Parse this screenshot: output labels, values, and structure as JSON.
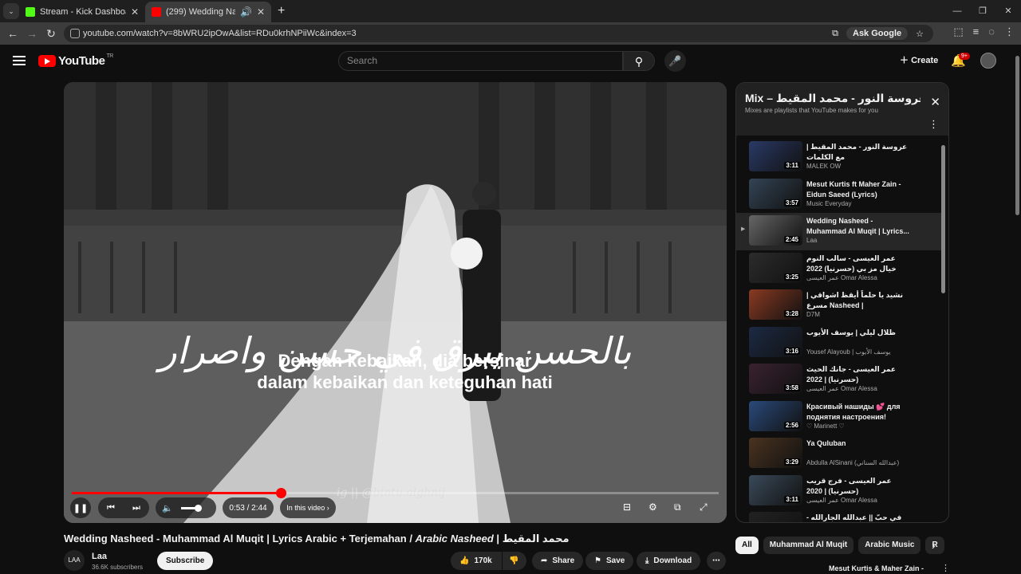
{
  "browser": {
    "tabs": [
      {
        "title": "Stream - Kick Dashboard",
        "favicon_color": "#53fc18"
      },
      {
        "title": "(299) Wedding Nasheed - M",
        "favicon_color": "#ff0000"
      }
    ],
    "url": "youtube.com/watch?v=8bWRU2ipOwA&list=RDu0krhNPiiWc&index=3",
    "ask_google": "Ask Google"
  },
  "header": {
    "logo": "YouTube",
    "logo_region": "TR",
    "search_placeholder": "Search",
    "create_label": "Create",
    "notif_badge": "9+"
  },
  "player": {
    "arabic_lyric": "بالحسن يبرق في حسن واصرار",
    "subtitle_line1": "Dengan kebaikan, dia bersinar",
    "subtitle_line2": "dalam kebaikan dan keteguhan hati",
    "watermark": "ig || @bintu.alghnij",
    "time": "0:53 / 2:44",
    "in_this_video": "In this video",
    "progress_fraction": 0.323,
    "volume_fraction": 0.45
  },
  "playlist": {
    "title": "Mix – عروسة النور - محمد المقيط |...",
    "subtitle": "Mixes are playlists that YouTube makes for you",
    "items": [
      {
        "title": "عروسة النور - محمد المقيط | مع الكلمات",
        "channel": "MALEK OW",
        "duration": "3:11",
        "color": "#2a3a66"
      },
      {
        "title": "Mesut Kurtis ft Maher Zain - Eidun Saeed (Lyrics)",
        "channel": "Music Everyday",
        "duration": "3:57",
        "color": "#334455"
      },
      {
        "title": "Wedding Nasheed - Muhammad Al Muqit | Lyrics...",
        "channel": "Laa",
        "duration": "2:45",
        "color": "#666666",
        "current": true
      },
      {
        "title": "عمر العيسى - سالب النوم خيال مز بي (حسرنيا) 2022",
        "channel": "عمر العيسى Omar Alessa",
        "duration": "3:25",
        "color": "#2c2c2c"
      },
      {
        "title": "نشيد يا حلماً أيقظ اشواقي | مسرع Nasheed |",
        "channel": "D7M",
        "duration": "3:28",
        "color": "#8a3a22"
      },
      {
        "title": "ظلال ليلي | يوسف الأيوب",
        "channel": "Yousef Alayoub | يوسف الأيوب",
        "duration": "3:16",
        "color": "#1c2a44"
      },
      {
        "title": "عمر العيسى - جانك الحيث (حسرنيا) | 2022",
        "channel": "عمر العيسى Omar Alessa",
        "duration": "3:58",
        "color": "#3a2230"
      },
      {
        "title": "Красивый нашиды 💕 для поднятия настроения!",
        "channel": "♡ Marinett ♡",
        "duration": "2:56",
        "color": "#2a4a7a"
      },
      {
        "title": "Ya Quluban",
        "channel": "Abdulla AlSinani (عبدالله السناني)",
        "duration": "3:29",
        "color": "#4a3320"
      },
      {
        "title": "عمر العيسى - فرج قريب (حسرنيا) | 2020",
        "channel": "عمر العيسى Omar Alessa",
        "duration": "3:11",
        "color": "#3a4a5a"
      },
      {
        "title": "في حبّ || عبدالله الجارالله - أحمد النفيس",
        "channel": "",
        "duration": "",
        "color": "#222222"
      }
    ]
  },
  "video": {
    "title": "Wedding Nasheed - Muhammad Al Muqit | Lyrics Arabic + Terjemahan / ",
    "title_italic": "Arabic Nasheed",
    "title_tail": " | محمد المقيط",
    "channel": "Laa",
    "channel_avatar": "LAA",
    "subscribers": "36.6K subscribers",
    "subscribe_label": "Subscribe",
    "likes": "170k",
    "share_label": "Share",
    "save_label": "Save",
    "download_label": "Download"
  },
  "chips": [
    "All",
    "Muhammad Al Muqit",
    "Arabic Music",
    "R"
  ],
  "next_preview": "Mesut Kurtis & Maher Zain -"
}
